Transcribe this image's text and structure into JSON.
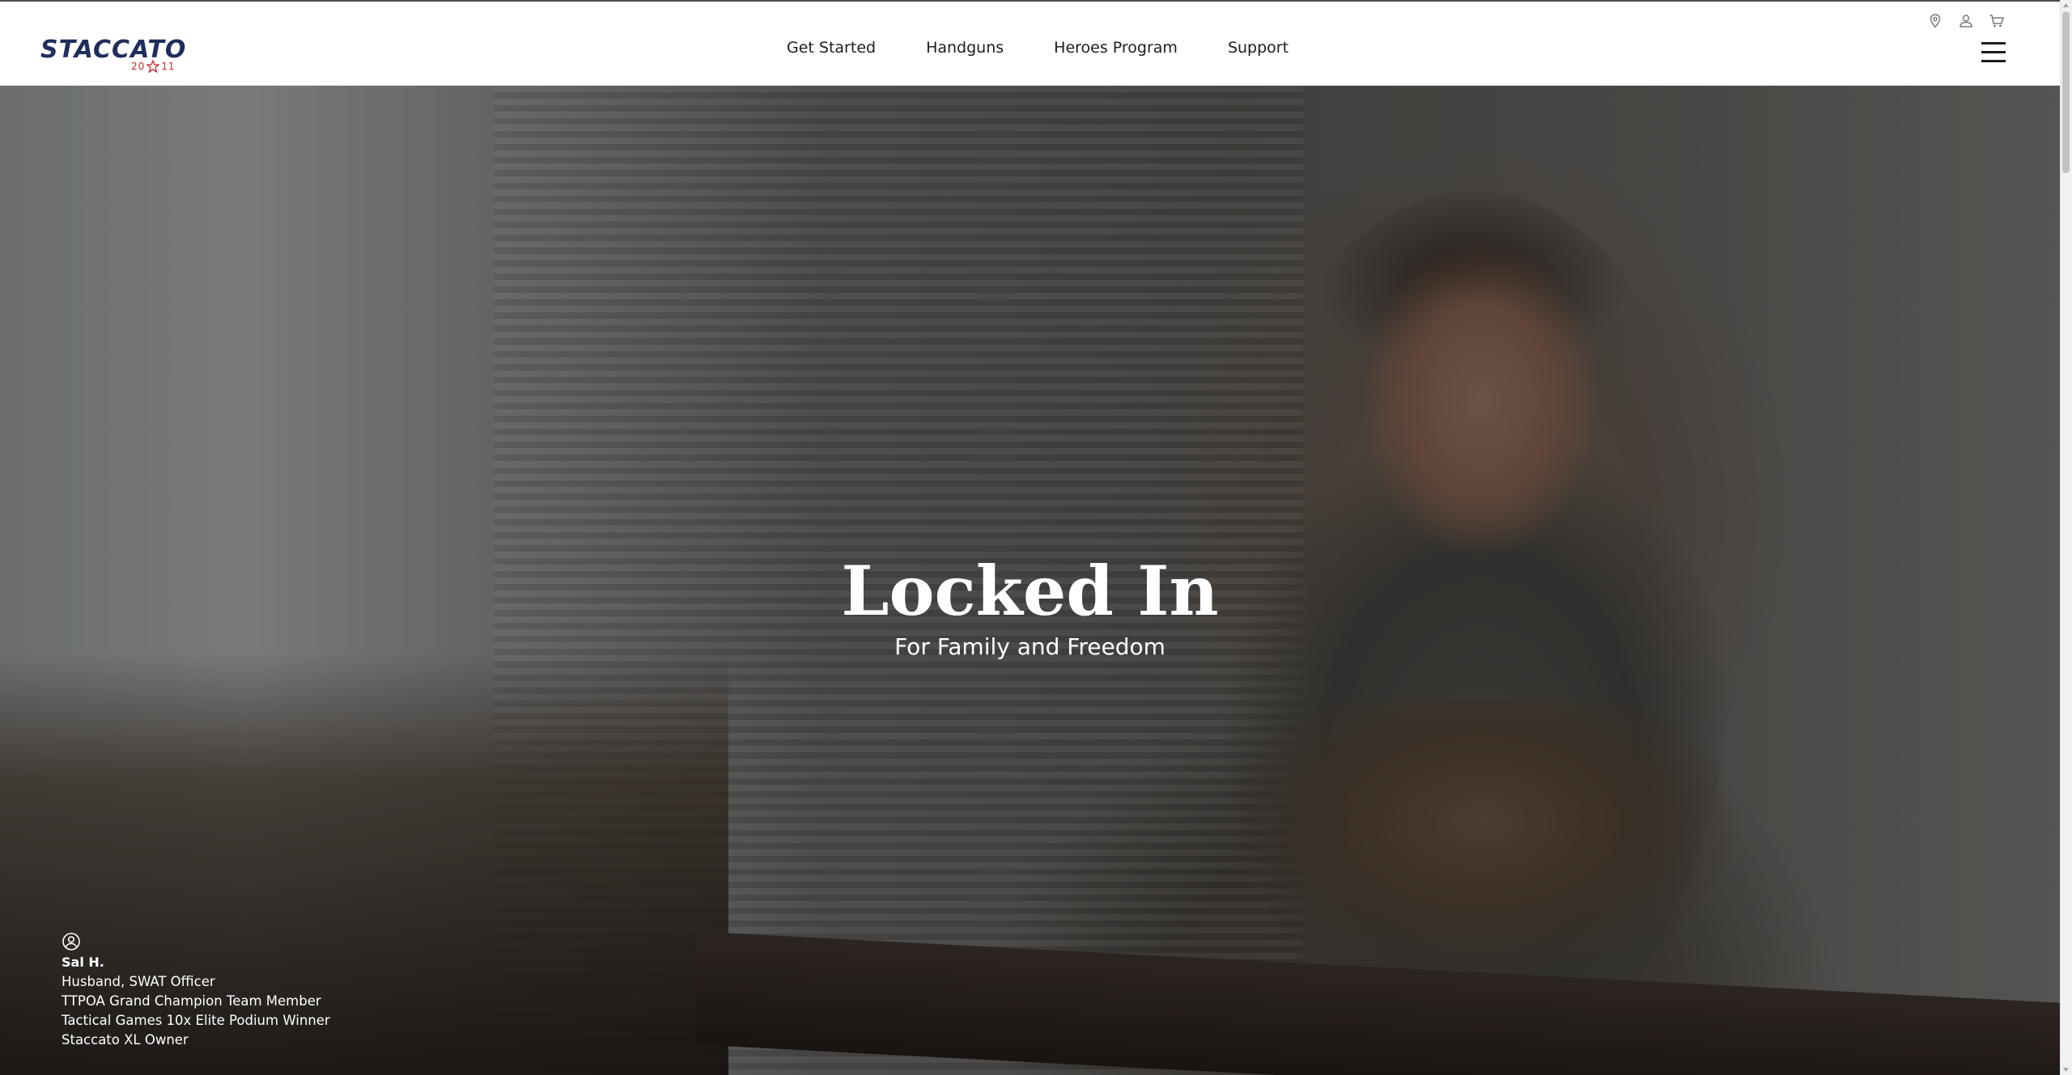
{
  "brand": {
    "wordmark": "STACCATO",
    "sub_left": "20",
    "sub_right": "11"
  },
  "nav": {
    "items": [
      {
        "label": "Get Started"
      },
      {
        "label": "Handguns"
      },
      {
        "label": "Heroes Program"
      },
      {
        "label": "Support"
      }
    ]
  },
  "utility_icons": [
    "location-pin-icon",
    "account-icon",
    "cart-icon"
  ],
  "hero": {
    "title": "Locked In",
    "subtitle": "For Family and Freedom",
    "bio": {
      "name": "Sal H.",
      "lines": [
        "Husband, SWAT Officer",
        "TTPOA Grand Champion Team Member",
        "Tactical Games 10x Elite Podium Winner",
        "Staccato XL Owner"
      ]
    }
  },
  "colors": {
    "brand_navy": "#1f2e5c",
    "brand_red": "#c8252c",
    "nav_text": "#1d1d1d",
    "hero_text": "#ffffff"
  }
}
